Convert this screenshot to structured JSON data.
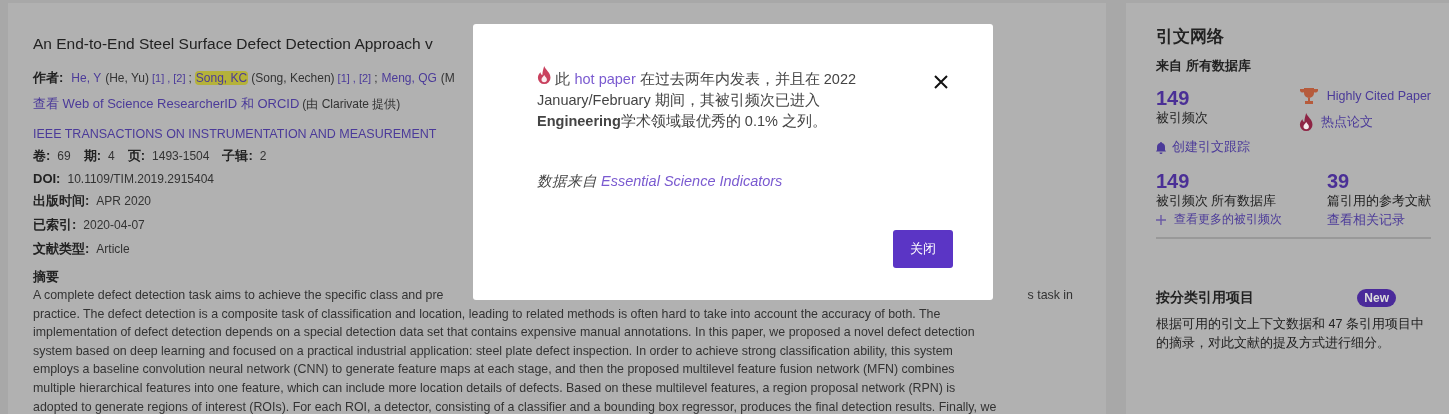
{
  "article": {
    "title": "An End-to-End Steel Surface Defect Detection Approach v",
    "authors_label": "作者:",
    "author_separator": ";",
    "ref_separator": ",",
    "authors": [
      {
        "name": "He, Y",
        "full": "(He, Yu)",
        "refs": [
          "[1]",
          "[2]"
        ],
        "highlighted": false
      },
      {
        "name": "Song, KC",
        "full": "(Song, Kechen)",
        "refs": [
          "[1]",
          "[2]"
        ],
        "highlighted": true
      },
      {
        "name": "Meng, QG",
        "full": "(M",
        "highlighted": false
      }
    ],
    "researcher_link": "查看 Web of Science ResearcherID 和 ORCID",
    "researcher_note": "(由 Clarivate 提供)",
    "journal": "IEEE TRANSACTIONS ON INSTRUMENTATION AND MEASUREMENT",
    "volume_fields": [
      {
        "label": "卷:",
        "value": "69"
      },
      {
        "label": "期:",
        "value": "4"
      },
      {
        "label": "页:",
        "value": "1493-1504"
      },
      {
        "label": "子辑:",
        "value": "2"
      }
    ],
    "fields": [
      {
        "label": "DOI:",
        "value": "10.1109/TIM.2019.2915404"
      },
      {
        "label": "出版时间:",
        "value": "APR 2020"
      },
      {
        "label": "已索引:",
        "value": "2020-04-07"
      },
      {
        "label": "文献类型:",
        "value": "Article"
      }
    ],
    "abstract_heading": "摘要",
    "abstract_first_line": [
      "A complete defect detection task aims to achieve the specific class and pre",
      "s task in"
    ],
    "abstract_lines": [
      "practice. The defect detection is a composite task of classification and location, leading to related methods is often hard to take into account the accuracy of both. The",
      "implementation of defect detection depends on a special detection data set that contains expensive manual annotations. In this paper, we proposed a novel defect detection",
      "system based on deep learning and focused on a practical industrial application: steel plate defect inspection. In order to achieve strong classification ability, this system",
      "employs a baseline convolution neural network (CNN) to generate feature maps at each stage, and then the proposed multilevel feature fusion network (MFN) combines",
      "multiple hierarchical features into one feature, which can include more location details of defects. Based on these multilevel features, a region proposal network (RPN) is",
      "adopted to generate regions of interest (ROIs). For each ROI, a detector, consisting of a classifier and a bounding box regressor, produces the final detection results. Finally, we"
    ]
  },
  "citation_network": {
    "title": "引文网络",
    "source": "来自 所有数据库",
    "count": "149",
    "count_label": "被引频次",
    "badges": [
      {
        "kind": "trophy",
        "label": "Highly Cited Paper"
      },
      {
        "kind": "flame",
        "label": "热点论文"
      }
    ],
    "alert_link": "创建引文跟踪",
    "stats": [
      {
        "number": "149",
        "label": "被引频次 所有数据库",
        "link": "查看更多的被引频次",
        "plus": true
      },
      {
        "number": "39",
        "label": "篇引用的参考文献",
        "link": "查看相关记录",
        "plus": false
      }
    ]
  },
  "classified": {
    "title": "按分类引用项目",
    "badge": "New",
    "description": "根据可用的引文上下文数据和 47 条引用项目中的摘录，对此文献的提及方式进行细分。"
  },
  "modal": {
    "prefix": "此",
    "link": "hot paper",
    "message": "在过去两年内发表，并且在 2022 January/February 期间，其被引频次已进入 **Engineering**学术领域最优秀的 0.1% 之列。",
    "source_label": "数据来自",
    "source_link": "Essential Science Indicators",
    "button": "关闭"
  }
}
